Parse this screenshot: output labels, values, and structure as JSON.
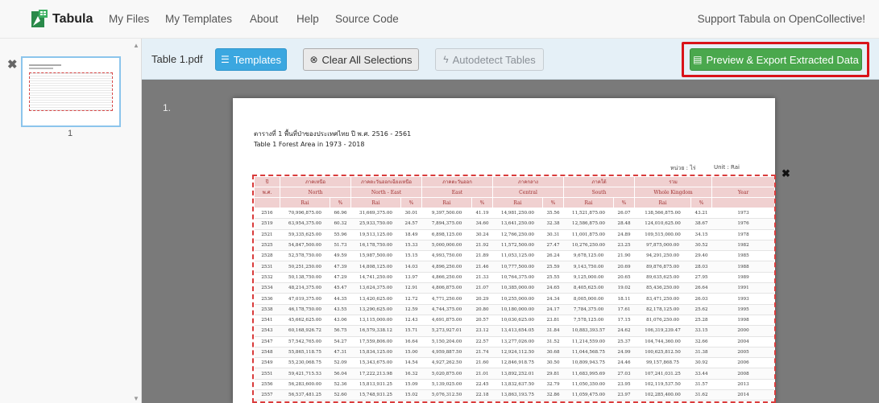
{
  "navbar": {
    "brand": "Tabula",
    "links": [
      "My Files",
      "My Templates",
      "About",
      "Help",
      "Source Code"
    ],
    "support": "Support Tabula on OpenCollective!"
  },
  "sidebar": {
    "page_label": "1"
  },
  "toolbar": {
    "filename": "Table 1.pdf",
    "templates": "Templates",
    "clear": "Clear All Selections",
    "autodetect": "Autodetect Tables",
    "export": "Preview & Export Extracted Data"
  },
  "main": {
    "page_number": "1."
  },
  "doc": {
    "title_th": "ตารางที่ 1  พื้นที่ป่าของประเทศไทย ปี พ.ศ. 2516 - 2561",
    "title_en": "Table 1  Forest Area in 1973 - 2018",
    "unit_th": "หน่วย : ไร่",
    "unit_en": "Unit : Rai",
    "header_regions_th": [
      "ภาคเหนือ",
      "ภาคตะวันออกเฉียงเหนือ",
      "ภาคตะวันออก",
      "ภาคกลาง",
      "ภาคใต้",
      "รวม"
    ],
    "header_regions_en": [
      "North",
      "North - East",
      "East",
      "Central",
      "South",
      "Whole Kingdom"
    ],
    "header_year_th": "ปี",
    "header_year_th2": "พ.ศ.",
    "header_year_en": "Year",
    "header_rai_th": "ไร่",
    "header_rai_en": "Rai",
    "header_pct": "%",
    "rows": [
      [
        "2516",
        "70,996,875.00",
        "66.96",
        "31,669,375.00",
        "30.01",
        "9,397,500.00",
        "41.19",
        "14,981,250.00",
        "35.56",
        "11,521,875.00",
        "26.07",
        "138,566,875.00",
        "43.21",
        "1973"
      ],
      [
        "2519",
        "63,954,375.00",
        "60.32",
        "25,933,750.00",
        "24.57",
        "7,894,375.00",
        "34.60",
        "13,641,250.00",
        "32.38",
        "12,586,875.00",
        "28.48",
        "124,010,625.00",
        "38.67",
        "1976"
      ],
      [
        "2521",
        "59,335,625.00",
        "55.96",
        "19,513,125.00",
        "18.49",
        "6,898,125.00",
        "30.24",
        "12,766,250.00",
        "30.31",
        "11,001,875.00",
        "24.89",
        "109,515,000.00",
        "34.15",
        "1978"
      ],
      [
        "2525",
        "54,847,500.00",
        "51.73",
        "16,178,750.00",
        "15.33",
        "5,000,000.00",
        "21.92",
        "11,572,500.00",
        "27.47",
        "10,276,250.00",
        "23.25",
        "97,875,000.00",
        "30.52",
        "1982"
      ],
      [
        "2528",
        "52,578,750.00",
        "49.59",
        "15,987,500.00",
        "15.15",
        "4,993,750.00",
        "21.89",
        "11,053,125.00",
        "26.24",
        "9,678,125.00",
        "21.90",
        "94,291,250.00",
        "29.40",
        "1985"
      ],
      [
        "2531",
        "50,251,250.00",
        "47.39",
        "14,808,125.00",
        "14.03",
        "4,896,250.00",
        "21.46",
        "10,777,500.00",
        "25.59",
        "9,143,750.00",
        "20.69",
        "89,876,875.00",
        "28.03",
        "1988"
      ],
      [
        "2532",
        "50,138,750.00",
        "47.29",
        "14,741,250.00",
        "13.97",
        "4,866,250.00",
        "21.33",
        "10,764,375.00",
        "25.55",
        "9,125,000.00",
        "20.65",
        "89,635,625.00",
        "27.95",
        "1989"
      ],
      [
        "2534",
        "48,214,375.00",
        "45.47",
        "13,624,375.00",
        "12.91",
        "4,806,875.00",
        "21.07",
        "10,385,000.00",
        "24.65",
        "8,405,625.00",
        "19.02",
        "85,436,250.00",
        "26.64",
        "1991"
      ],
      [
        "2536",
        "47,019,375.00",
        "44.35",
        "13,420,625.00",
        "12.72",
        "4,771,250.00",
        "20.29",
        "10,255,000.00",
        "24.34",
        "8,005,000.00",
        "18.11",
        "83,471,250.00",
        "26.03",
        "1993"
      ],
      [
        "2538",
        "46,178,750.00",
        "43.55",
        "13,290,625.00",
        "12.59",
        "4,744,375.00",
        "20.80",
        "10,180,000.00",
        "24.17",
        "7,784,375.00",
        "17.61",
        "82,178,125.00",
        "25.62",
        "1995"
      ],
      [
        "2541",
        "45,662,625.00",
        "43.06",
        "13,115,000.00",
        "12.43",
        "4,691,875.00",
        "20.57",
        "10,030,625.00",
        "23.81",
        "7,578,125.00",
        "17.15",
        "81,076,250.00",
        "25.28",
        "1998"
      ],
      [
        "2543",
        "60,168,926.72",
        "56.75",
        "16,579,338.12",
        "15.71",
        "5,273,927.01",
        "23.12",
        "13,413,654.05",
        "31.84",
        "10,883,393.57",
        "24.62",
        "106,319,239.47",
        "33.15",
        "2000"
      ],
      [
        "2547",
        "57,542,765.00",
        "54.27",
        "17,559,806.00",
        "16.64",
        "5,150,204.00",
        "22.57",
        "13,277,026.00",
        "31.52",
        "11,214,559.00",
        "25.37",
        "104,744,360.00",
        "32.66",
        "2004"
      ],
      [
        "2548",
        "55,865,118.75",
        "47.31",
        "15,834,125.00",
        "15.00",
        "4,959,887.50",
        "21.74",
        "12,924,112.50",
        "30.68",
        "11,044,568.75",
        "24.99",
        "100,625,812.50",
        "31.38",
        "2005"
      ],
      [
        "2549",
        "55,230,068.75",
        "52.09",
        "15,343,675.00",
        "14.54",
        "4,927,262.50",
        "21.60",
        "12,846,918.75",
        "30.50",
        "10,809,943.75",
        "24.46",
        "99,157,868.75",
        "30.92",
        "2006"
      ],
      [
        "2551",
        "59,421,715.53",
        "56.04",
        "17,222,213.98",
        "16.32",
        "5,020,875.00",
        "21.01",
        "13,892,252.01",
        "29.81",
        "11,683,995.69",
        "27.03",
        "107,241,031.25",
        "33.44",
        "2008"
      ],
      [
        "2556",
        "56,283,600.00",
        "52.36",
        "15,813,931.25",
        "15.09",
        "5,139,025.00",
        "22.45",
        "13,832,637.50",
        "32.79",
        "11,050,350.00",
        "23.95",
        "102,119,537.50",
        "31.57",
        "2013"
      ],
      [
        "2557",
        "56,537,481.25",
        "52.60",
        "15,748,931.25",
        "15.02",
        "5,076,312.50",
        "22.18",
        "13,863,193.75",
        "32.86",
        "11,059,475.00",
        "23.97",
        "102,285,400.00",
        "31.62",
        "2014"
      ]
    ]
  }
}
